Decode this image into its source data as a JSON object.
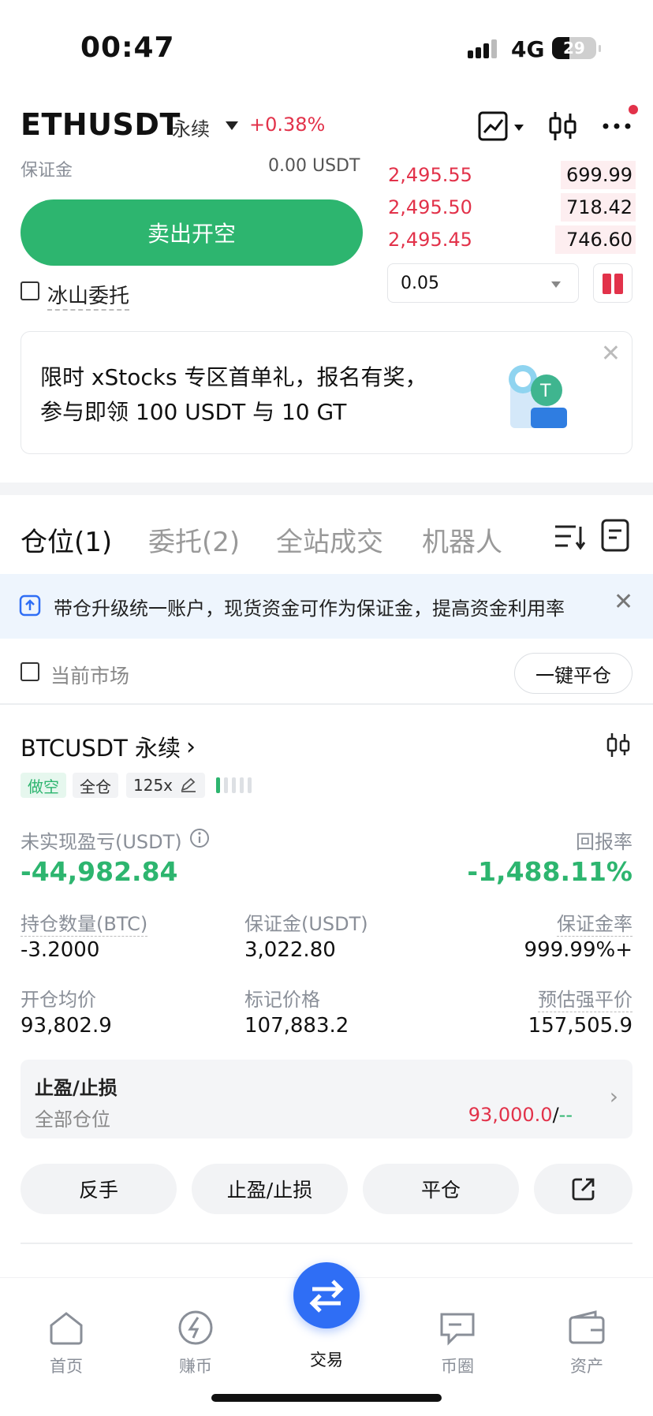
{
  "status_bar": {
    "time": "00:47",
    "network": "4G",
    "battery": "29"
  },
  "header": {
    "symbol": "ETHUSDT",
    "contract_type": "永续",
    "change": "+0.38%"
  },
  "order_form": {
    "margin_label": "保证金",
    "margin_value": "0.00 USDT",
    "sell_button": "卖出开空",
    "iceberg_label": "冰山委托"
  },
  "order_book": {
    "asks": [
      {
        "price": "2,495.55",
        "qty": "699.99",
        "depth": 0.3
      },
      {
        "price": "2,495.50",
        "qty": "718.42",
        "depth": 0.3
      },
      {
        "price": "2,495.45",
        "qty": "746.60",
        "depth": 0.32
      }
    ],
    "precision": "0.05"
  },
  "promo": {
    "line1": "限时 xStocks 专区首单礼，报名有奖，",
    "line2": "参与即领 100 USDT 与 10 GT"
  },
  "tabs": [
    "仓位(1)",
    "委托(2)",
    "全站成交",
    "机器人"
  ],
  "notice": {
    "text": "带仓升级统一账户，现货资金可作为保证金，提高资金利用率"
  },
  "filter": {
    "current_market": "当前市场",
    "close_all": "一键平仓"
  },
  "position": {
    "symbol": "BTCUSDT 永续",
    "side": "做空",
    "margin_mode": "全仓",
    "leverage": "125x",
    "pnl_label": "未实现盈亏(USDT)",
    "pnl_value": "-44,982.84",
    "roe_label": "回报率",
    "roe_value": "-1,488.11%",
    "qty_label": "持仓数量(BTC)",
    "qty_value": "-3.2000",
    "margin_label": "保证金(USDT)",
    "margin_value": "3,022.80",
    "margin_ratio_label": "保证金率",
    "margin_ratio_value": "999.99%+",
    "entry_label": "开仓均价",
    "entry_value": "93,802.9",
    "mark_label": "标记价格",
    "mark_value": "107,883.2",
    "liq_label": "预估强平价",
    "liq_value": "157,505.9",
    "tpsl_title": "止盈/止损",
    "tpsl_scope": "全部仓位",
    "tp_value": "93,000.0",
    "tpsl_sep": "/",
    "sl_value": "--"
  },
  "actions": {
    "reverse": "反手",
    "tpsl": "止盈/止损",
    "close": "平仓"
  },
  "bottom_nav": [
    "首页",
    "赚币",
    "交易",
    "币圈",
    "资产"
  ],
  "colors": {
    "green": "#2db56f",
    "red": "#e2324a",
    "blue": "#2f6ef5"
  }
}
